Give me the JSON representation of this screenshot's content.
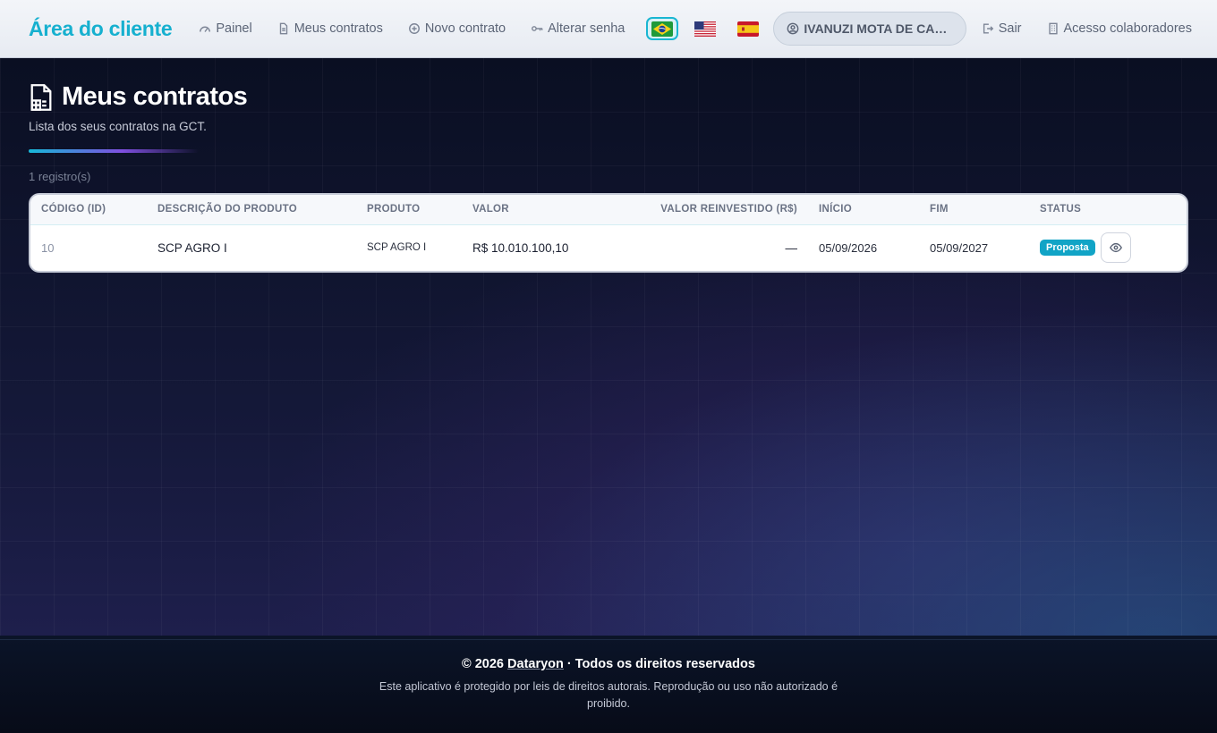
{
  "header": {
    "brand": "Área do cliente",
    "nav": [
      {
        "label": "Painel",
        "icon": "dashboard-icon"
      },
      {
        "label": "Meus contratos",
        "icon": "document-icon"
      },
      {
        "label": "Novo contrato",
        "icon": "plus-circle-icon"
      },
      {
        "label": "Alterar senha",
        "icon": "key-icon"
      }
    ],
    "languages": [
      {
        "code": "pt-BR",
        "flag": "brazil-flag-icon",
        "active": true
      },
      {
        "code": "en-US",
        "flag": "usa-flag-icon",
        "active": false
      },
      {
        "code": "es-ES",
        "flag": "spain-flag-icon",
        "active": false
      }
    ],
    "user_name": "IVANUZI MOTA DE CARVA...",
    "logout_label": "Sair",
    "staff_label": "Acesso colaboradores"
  },
  "page": {
    "title": "Meus contratos",
    "subtitle": "Lista dos seus contratos na GCT.",
    "record_count": "1 registro(s)"
  },
  "table": {
    "columns": [
      "CÓDIGO (ID)",
      "DESCRIÇÃO DO PRODUTO",
      "PRODUTO",
      "VALOR",
      "VALOR REINVESTIDO (R$)",
      "INÍCIO",
      "FIM",
      "STATUS"
    ],
    "rows": [
      {
        "id": "10",
        "description": "SCP AGRO I",
        "product": "SCP AGRO I",
        "value": "R$ 10.010.100,10",
        "reinvested": "—",
        "start": "05/09/2026",
        "end": "05/09/2027",
        "status": "Proposta"
      }
    ]
  },
  "footer": {
    "copyright_prefix": "© 2026",
    "company": "Dataryon",
    "copyright_suffix": "· Todos os direitos reservados",
    "disclaimer": "Este aplicativo é protegido por leis de direitos autorais. Reprodução ou uso não autorizado é proibido."
  },
  "colors": {
    "brand": "#16b0cf",
    "status_badge": "#11a4c6",
    "accent_gradient_start": "#17b8d8",
    "accent_gradient_end": "#7f4fe0"
  }
}
